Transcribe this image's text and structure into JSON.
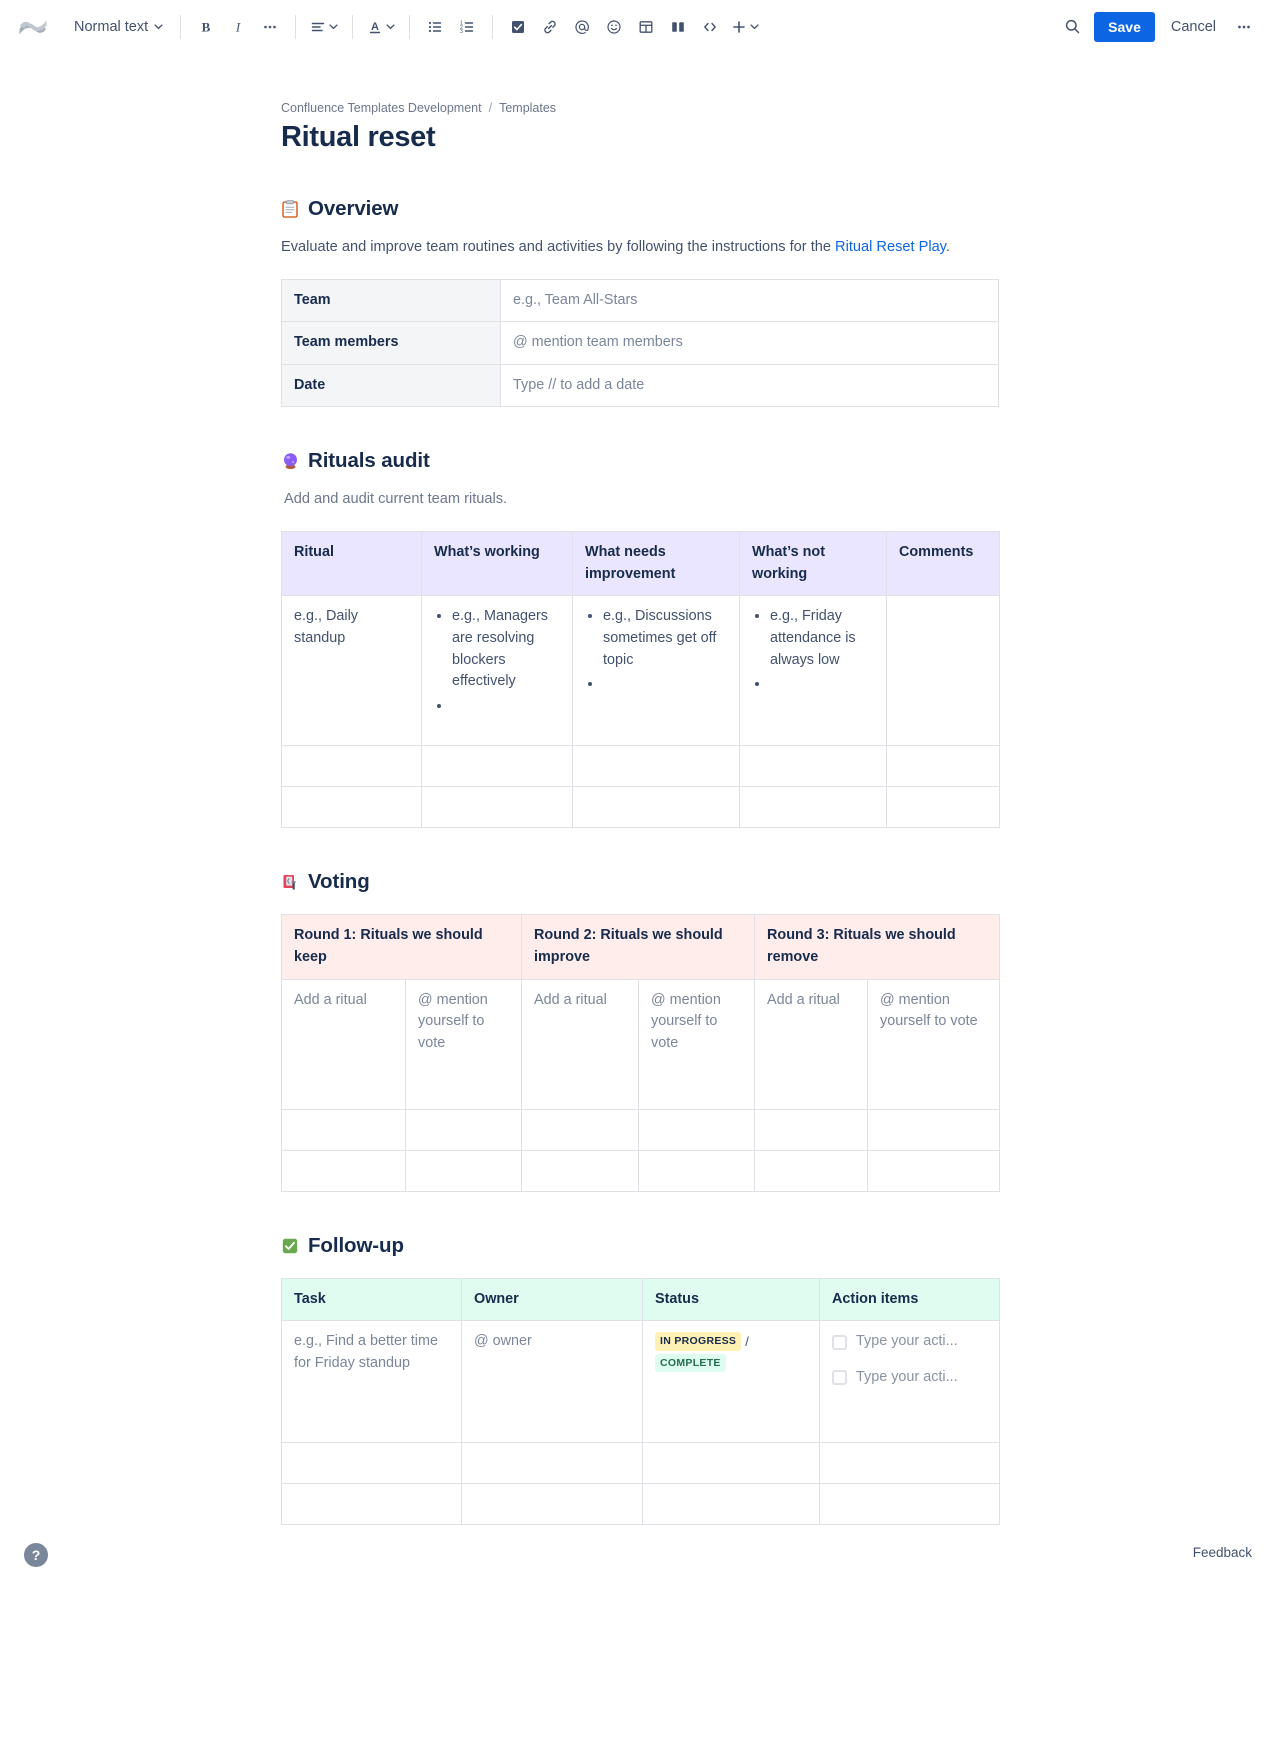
{
  "toolbar": {
    "logo_name": "confluence-logo",
    "style_select": "Normal text",
    "bold": "B",
    "italic": "I",
    "more_formatting": "•••",
    "save_label": "Save",
    "cancel_label": "Cancel",
    "more_label": "•••",
    "accent_color": "#0c66e4"
  },
  "breadcrumb": {
    "space": "Confluence Templates Development",
    "separator": "/",
    "parent": "Templates"
  },
  "page": {
    "title": "Ritual reset"
  },
  "overview": {
    "heading": "Overview",
    "emoji": "clipboard-emoji",
    "paragraph_before": "Evaluate and improve team routines and activities by following the instructions for the ",
    "link_text": "Ritual Reset Play",
    "paragraph_after": ".",
    "rows": [
      {
        "label": "Team",
        "value": "e.g., Team All-Stars"
      },
      {
        "label": "Team members",
        "value": "@ mention team members"
      },
      {
        "label": "Date",
        "value": "Type // to add a date"
      }
    ],
    "header_bg": "#f4f5f7"
  },
  "rituals_audit": {
    "heading": "Rituals audit",
    "emoji": "crystal-ball-emoji",
    "description": "Add and audit current team rituals.",
    "header_bg": "#eae6ff",
    "columns": [
      "Ritual",
      "What’s working",
      "What needs improvement",
      "What’s not working",
      "Comments"
    ],
    "row1": {
      "ritual": "e.g., Daily standup",
      "whats_working": [
        "e.g., Managers are resolving blockers effectively",
        ""
      ],
      "needs_improvement": [
        "e.g., Discussions sometimes get off topic",
        ""
      ],
      "not_working": [
        "e.g., Friday attendance is always low",
        ""
      ],
      "comments": ""
    },
    "empty_rows": 2
  },
  "voting": {
    "heading": "Voting",
    "emoji": "ballot-box-emoji",
    "header_bg": "#ffedeb",
    "columns": [
      "Round 1: Rituals we should keep",
      "Round 2: Rituals we should improve",
      "Round 3: Rituals we should remove"
    ],
    "row1": [
      "Add a ritual",
      "@ mention yourself to vote",
      "Add a ritual",
      "@ mention yourself to vote",
      "Add a ritual",
      "@ mention yourself to vote"
    ],
    "empty_rows": 2
  },
  "follow_up": {
    "heading": "Follow-up",
    "emoji": "check-mark-button-emoji",
    "header_bg": "#dffcf0",
    "columns": [
      "Task",
      "Owner",
      "Status",
      "Action items"
    ],
    "row1": {
      "task": "e.g., Find a better time for Friday standup",
      "owner": "@ owner",
      "status_in_progress": "IN PROGRESS",
      "status_separator": "/",
      "status_complete": "COMPLETE",
      "action_items": [
        "Type your acti...",
        "Type your acti..."
      ]
    },
    "empty_rows": 2,
    "lozenge_yellow": "#fff0b3",
    "lozenge_green": "#dffcf0"
  },
  "footer": {
    "help_label": "?",
    "feedback_label": "Feedback"
  }
}
